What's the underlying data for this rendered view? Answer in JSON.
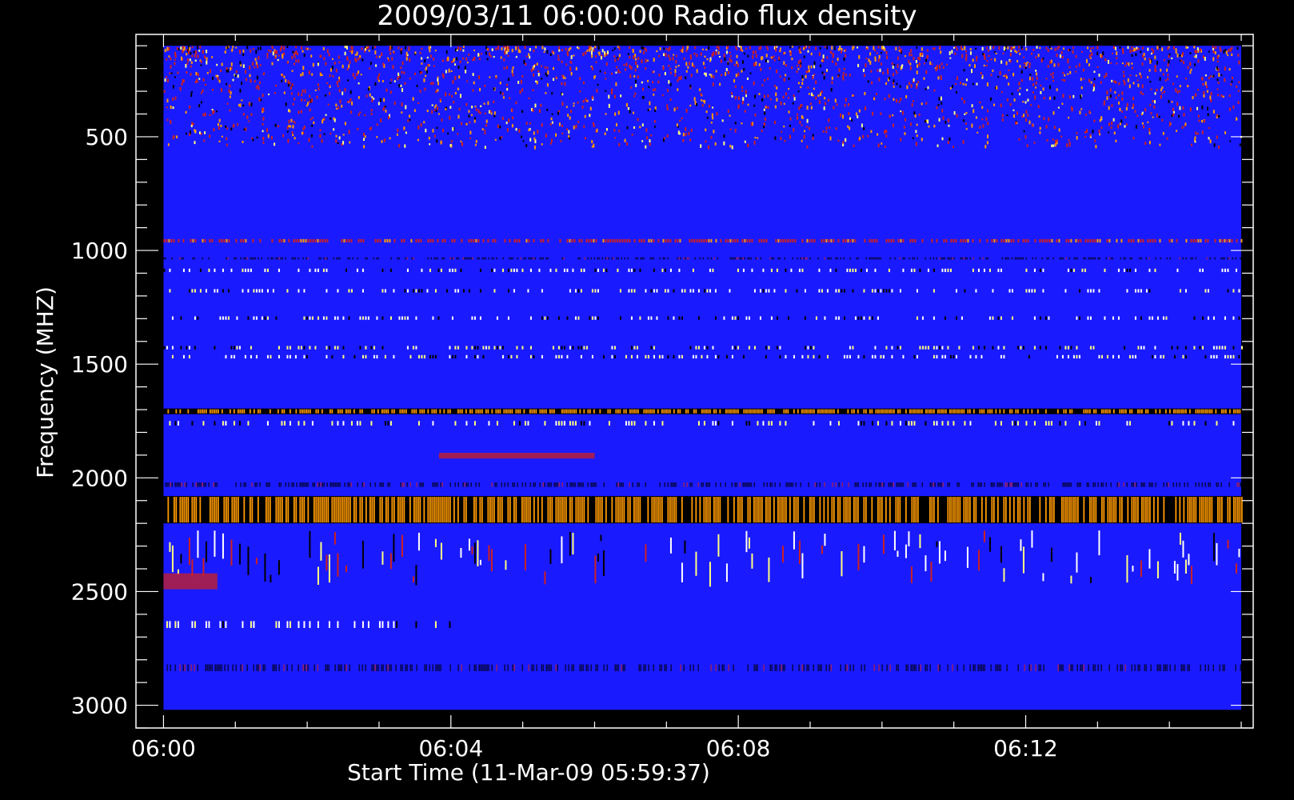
{
  "chart_data": {
    "type": "heatmap",
    "title": "2009/03/11 06:00:00 Radio flux density",
    "xlabel": "Start Time (11-Mar-09 05:59:37)",
    "ylabel": "Frequency (MHZ)",
    "x_axis": {
      "units": "time",
      "range": [
        "05:59:37",
        "06:15:10"
      ],
      "data_range": [
        "06:00:00",
        "06:15:00"
      ],
      "major_ticks": [
        "06:00",
        "06:04",
        "06:08",
        "06:12"
      ],
      "minor_tick_interval_minutes": 1
    },
    "y_axis": {
      "units": "MHz",
      "range": [
        3100,
        50
      ],
      "inverted": true,
      "data_range": [
        100,
        3020
      ],
      "major_ticks": [
        500,
        1000,
        1500,
        2000,
        2500,
        3000
      ],
      "minor_tick_interval": 100
    },
    "background_color": "#1a1aff",
    "colors": {
      "blue": "#1a1aff",
      "red": "#cc2020",
      "orange": "#ff9a00",
      "yellow": "#ffff80",
      "black": "#000000"
    },
    "features": [
      {
        "name": "high-noise",
        "freq_range": [
          100,
          540
        ],
        "pattern": "dense red/orange speckle",
        "time_range": [
          "06:00:00",
          "06:15:00"
        ]
      },
      {
        "name": "narrow-band",
        "freq_range": [
          950,
          965
        ],
        "pattern": "thin red line",
        "time_range": [
          "06:00:00",
          "06:15:00"
        ]
      },
      {
        "name": "rfi-band",
        "freq_range": [
          1030,
          1040
        ],
        "pattern": "dark band with red",
        "time_range": [
          "06:00:00",
          "06:15:00"
        ]
      },
      {
        "name": "rfi-band",
        "freq_range": [
          1080,
          1095
        ],
        "pattern": "white ticks",
        "time_range": [
          "06:00:00",
          "06:15:00"
        ]
      },
      {
        "name": "rfi-band",
        "freq_range": [
          1170,
          1185
        ],
        "pattern": "white ticks",
        "time_range": [
          "06:00:00",
          "06:15:00"
        ]
      },
      {
        "name": "rfi-band",
        "freq_range": [
          1290,
          1305
        ],
        "pattern": "white ticks",
        "time_range": [
          "06:00:00",
          "06:15:00"
        ]
      },
      {
        "name": "rfi-band",
        "freq_range": [
          1420,
          1435
        ],
        "pattern": "yellow/white ticks",
        "time_range": [
          "06:00:00",
          "06:15:00"
        ]
      },
      {
        "name": "rfi-band",
        "freq_range": [
          1460,
          1475
        ],
        "pattern": "white ticks",
        "time_range": [
          "06:00:00",
          "06:15:00"
        ]
      },
      {
        "name": "rfi-band",
        "freq_range": [
          1695,
          1720
        ],
        "pattern": "orange with black",
        "time_range": [
          "06:00:00",
          "06:15:00"
        ]
      },
      {
        "name": "rfi-band",
        "freq_range": [
          1750,
          1770
        ],
        "pattern": "yellow/white ticks",
        "time_range": [
          "06:00:00",
          "06:15:00"
        ]
      },
      {
        "name": "burst-patch",
        "freq_range": [
          1890,
          1915
        ],
        "pattern": "red patch",
        "time_range": [
          "06:03:50",
          "06:06:00"
        ]
      },
      {
        "name": "rfi-band",
        "freq_range": [
          2020,
          2040
        ],
        "pattern": "dark band",
        "time_range": [
          "06:00:00",
          "06:15:00"
        ]
      },
      {
        "name": "rfi-band",
        "freq_range": [
          2080,
          2200
        ],
        "pattern": "red/orange with black core",
        "time_range": [
          "06:00:00",
          "06:15:00"
        ]
      },
      {
        "name": "rfi-band",
        "freq_range": [
          2230,
          2480
        ],
        "pattern": "mixed ticks",
        "time_range": [
          "06:00:00",
          "06:15:00"
        ]
      },
      {
        "name": "noise-patch",
        "freq_range": [
          2420,
          2490
        ],
        "pattern": "red patch",
        "time_range": [
          "06:00:00",
          "06:00:45"
        ]
      },
      {
        "name": "sparse-ticks",
        "freq_range": [
          2630,
          2660
        ],
        "pattern": "white ticks",
        "time_range": [
          "06:00:00",
          "06:04:00"
        ]
      },
      {
        "name": "noise-band",
        "freq_range": [
          2820,
          2850
        ],
        "pattern": "dark striations",
        "time_range": [
          "06:00:00",
          "06:15:00"
        ]
      }
    ]
  }
}
